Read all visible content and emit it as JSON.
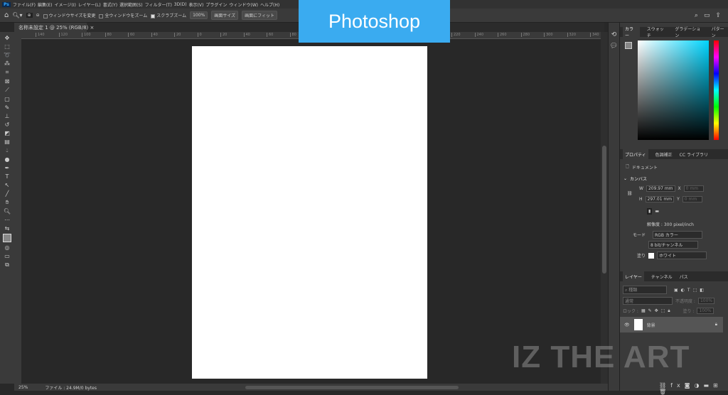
{
  "menubar": {
    "logo": "Ps",
    "items": [
      "ファイル(F)",
      "編集(E)",
      "イメージ(I)",
      "レイヤー(L)",
      "書式(Y)",
      "選択範囲(S)",
      "フィルター(T)",
      "3D(D)",
      "表示(V)",
      "プラグイン",
      "ウィンドウ(W)",
      "ヘルプ(H)"
    ]
  },
  "options": {
    "resize_windows": "ウィンドウサイズを変更",
    "zoom_all": "全ウィンドウをズーム",
    "scrubby_zoom": "スクラブズーム",
    "zoom_value": "100%",
    "fit_screen": "画面サイズ",
    "fill_screen": "画面にフィット"
  },
  "banner": "Photoshop",
  "document": {
    "tab": "名称未設定 1 @ 25% (RGB/8)",
    "zoom": "25%",
    "file_info": "ファイル : 24.9M/0 bytes"
  },
  "ruler_ticks": [
    "140",
    "120",
    "100",
    "80",
    "60",
    "40",
    "20",
    "0",
    "20",
    "40",
    "60",
    "80",
    "100",
    "120",
    "140",
    "160",
    "180",
    "200",
    "220",
    "240",
    "260",
    "280",
    "300",
    "320",
    "340"
  ],
  "color_panel": {
    "tabs": [
      "カラー",
      "スウォッチ",
      "グラデーション",
      "パターン"
    ],
    "active": 0
  },
  "properties": {
    "tabs": [
      "プロパティ",
      "色調補正",
      "CC ライブラリ"
    ],
    "type": "ドキュメント",
    "section": "カンバス",
    "w_label": "W",
    "w": "209.97 mm",
    "h_label": "H",
    "h": "297.01 mm",
    "x_label": "X",
    "x": "0 mm",
    "y_label": "Y",
    "y": "0 mm",
    "resolution": "解像度 : 300 pixel/inch",
    "mode_label": "モード",
    "mode": "RGB カラー",
    "depth": "8 bit/チャンネル",
    "fill_label": "塗り",
    "fill": "ホワイト"
  },
  "layers": {
    "tabs": [
      "レイヤー",
      "チャンネル",
      "パス"
    ],
    "search": "種類",
    "blend": "通常",
    "opacity_label": "不透明度 :",
    "opacity": "100%",
    "lock_label": "ロック :",
    "fill_label": "塗り :",
    "fill": "100%",
    "items": [
      {
        "name": "背景"
      }
    ]
  },
  "watermark": "IZ THE ART"
}
